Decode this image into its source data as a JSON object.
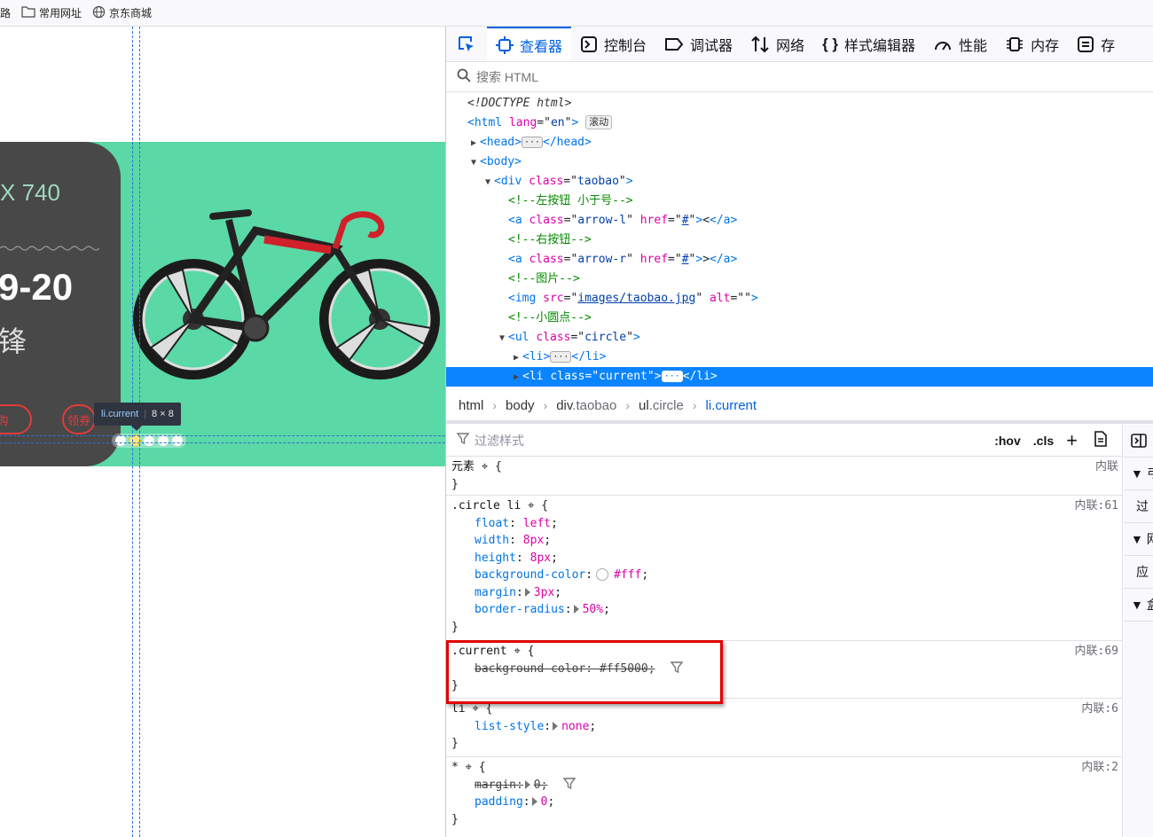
{
  "bookmarks": [
    {
      "label": "上路",
      "icon": "none"
    },
    {
      "label": "常用网址",
      "icon": "folder-icon"
    },
    {
      "label": "京东商城",
      "icon": "globe-icon"
    }
  ],
  "page": {
    "card_title": "X 740",
    "card_date": "9-20",
    "card_sub": "锋",
    "btn_left": "购",
    "btn_right": "领券",
    "tooltip_selector": "li.current",
    "tooltip_size": "8 × 8",
    "banner_color": "#5ad8a6"
  },
  "devtools": {
    "tabs": [
      {
        "label": "查看器",
        "icon": "inspector-icon",
        "active": true
      },
      {
        "label": "控制台",
        "icon": "console-icon"
      },
      {
        "label": "调试器",
        "icon": "debugger-icon"
      },
      {
        "label": "网络",
        "icon": "network-icon"
      },
      {
        "label": "样式编辑器",
        "icon": "style-editor-icon"
      },
      {
        "label": "性能",
        "icon": "performance-icon"
      },
      {
        "label": "内存",
        "icon": "memory-icon"
      },
      {
        "label": "存",
        "icon": "storage-icon"
      }
    ],
    "search_placeholder": "搜索 HTML",
    "markup": {
      "doctype": "<!DOCTYPE html>",
      "html_lang_value": "en",
      "scroll_badge": "滚动",
      "div_class": "taobao",
      "comment_left": "<!--左按钮 小于号-->",
      "a_left_class": "arrow-l",
      "a_left_href": "#",
      "a_left_text": "<",
      "comment_right": "<!--右按钮-->",
      "a_right_class": "arrow-r",
      "a_right_href": "#",
      "a_right_text": ">",
      "comment_img": "<!--图片-->",
      "img_src": "images/taobao.jpg",
      "img_alt": "",
      "comment_dots": "<!--小圆点-->",
      "ul_class": "circle",
      "li_current_class": "current"
    },
    "breadcrumbs": [
      {
        "tag": "html",
        "cls": ""
      },
      {
        "tag": "body",
        "cls": ""
      },
      {
        "tag": "div",
        "cls": ".taobao"
      },
      {
        "tag": "ul",
        "cls": ".circle"
      },
      {
        "tag": "li",
        "cls": ".current"
      }
    ],
    "filter_placeholder": "过滤样式",
    "hov_label": ":hov",
    "cls_label": ".cls",
    "plus_label": "+",
    "rules": {
      "element_selector": "元素",
      "element_source": "内联",
      "circle_selector": ".circle li",
      "circle_source": "内联:61",
      "float_name": "float",
      "float_value": "left",
      "width_name": "width",
      "width_value": "8px",
      "height_name": "height",
      "height_value": "8px",
      "bg_name": "background-color",
      "bg_value": "#fff",
      "margin_name": "margin",
      "margin_value": "3px",
      "radius_name": "border-radius",
      "radius_value": "50%",
      "current_selector": ".current",
      "current_source": "内联:69",
      "current_bg_name": "background-color",
      "current_bg_value": "#ff5000",
      "li_selector": "li",
      "li_source": "内联:6",
      "liststyle_name": "list-style",
      "liststyle_value": "none",
      "star_selector": "*",
      "star_source": "内联:2",
      "star_margin_name": "margin",
      "star_margin_value": "0",
      "star_padding_name": "padding",
      "star_padding_value": "0"
    },
    "side_rows": [
      "弓",
      "过",
      "网",
      "应",
      "盒"
    ]
  }
}
